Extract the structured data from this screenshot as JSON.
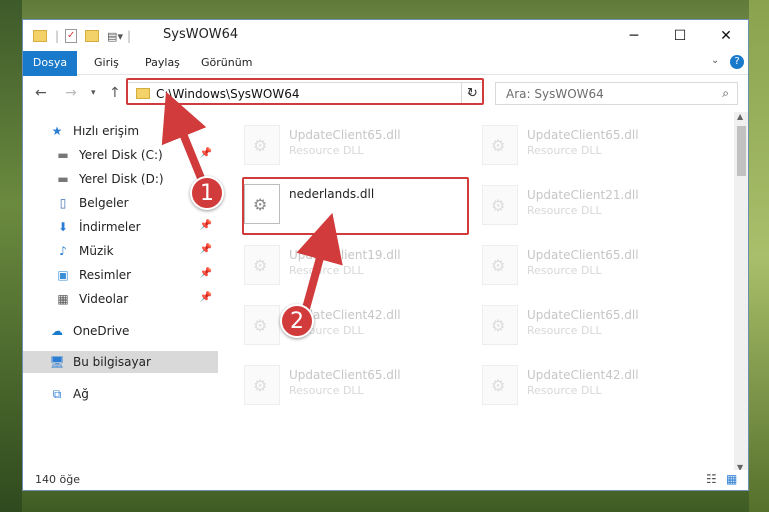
{
  "window": {
    "title": "SysWOW64"
  },
  "ribbon": {
    "tabs": [
      "Dosya",
      "Giriş",
      "Paylaş",
      "Görünüm"
    ]
  },
  "address": {
    "path": "C:\\Windows\\SysWOW64"
  },
  "search": {
    "placeholder": "Ara: SysWOW64"
  },
  "sidebar": {
    "items": [
      {
        "label": "Hızlı erişim",
        "icon": "star-icon"
      },
      {
        "label": "Yerel Disk (C:)",
        "icon": "drive-icon",
        "pinned": true
      },
      {
        "label": "Yerel Disk (D:)",
        "icon": "drive-icon"
      },
      {
        "label": "Belgeler",
        "icon": "document-icon",
        "pinned": true
      },
      {
        "label": "İndirmeler",
        "icon": "download-icon",
        "pinned": true
      },
      {
        "label": "Müzik",
        "icon": "music-icon",
        "pinned": true
      },
      {
        "label": "Resimler",
        "icon": "picture-icon",
        "pinned": true
      },
      {
        "label": "Videolar",
        "icon": "video-icon",
        "pinned": true
      },
      {
        "label": "OneDrive",
        "icon": "cloud-icon"
      },
      {
        "label": "Bu bilgisayar",
        "icon": "computer-icon",
        "selected": true
      },
      {
        "label": "Ağ",
        "icon": "network-icon"
      }
    ]
  },
  "files": [
    {
      "name": "UpdateClient65.dll",
      "type": "Resource DLL"
    },
    {
      "name": "UpdateClient65.dll",
      "type": "Resource DLL"
    },
    {
      "name": "nederlands.dll",
      "type": ""
    },
    {
      "name": "UpdateClient21.dll",
      "type": "Resource DLL"
    },
    {
      "name": "UpdateClient19.dll",
      "type": "Resource DLL"
    },
    {
      "name": "UpdateClient65.dll",
      "type": "Resource DLL"
    },
    {
      "name": "UpdateClient42.dll",
      "type": "Resource DLL"
    },
    {
      "name": "UpdateClient65.dll",
      "type": "Resource DLL"
    },
    {
      "name": "UpdateClient65.dll",
      "type": "Resource DLL"
    },
    {
      "name": "UpdateClient42.dll",
      "type": "Resource DLL"
    }
  ],
  "status": {
    "count": "140 öğe"
  },
  "annotations": {
    "step1": "1",
    "step2": "2"
  },
  "colors": {
    "accent": "#1979ca",
    "annotation": "#d23b3b"
  }
}
